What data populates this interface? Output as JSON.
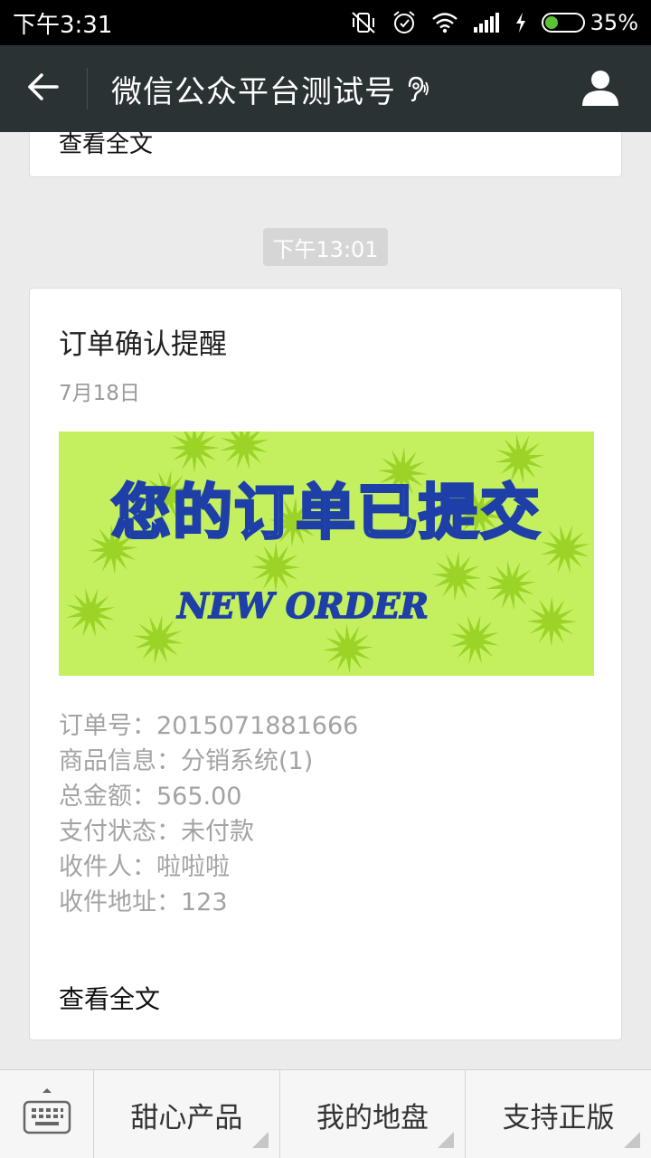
{
  "status_bar": {
    "time": "下午3:31",
    "battery_percent": "35%",
    "battery_level": 0.35,
    "icons": [
      "vibrate-off-icon",
      "alarm-icon",
      "wifi-icon",
      "signal-icon",
      "charging-icon",
      "battery-icon"
    ]
  },
  "header": {
    "title": "微信公众平台测试号",
    "back_icon": "back-arrow-icon",
    "ear_icon": "earpiece-icon",
    "profile_icon": "person-icon"
  },
  "previous_message": {
    "read_more": "查看全文"
  },
  "timestamp": "下午13:01",
  "message": {
    "title": "订单确认提醒",
    "date": "7月18日",
    "banner": {
      "headline": "您的订单已提交",
      "subline": "NEW ORDER",
      "background": "#c4f05f",
      "star_color": "#9bd327",
      "text_color": "#1e3fa8"
    },
    "details": [
      "订单号：2015071881666",
      "商品信息：分销系统(1)",
      "总金额：565.00",
      "支付状态：未付款",
      "收件人：啦啦啦",
      "收件地址：123"
    ],
    "read_more": "查看全文"
  },
  "bottom_menu": {
    "keyboard_icon": "keyboard-icon",
    "items": [
      {
        "label": "甜心产品"
      },
      {
        "label": "我的地盘"
      },
      {
        "label": "支持正版"
      }
    ]
  }
}
